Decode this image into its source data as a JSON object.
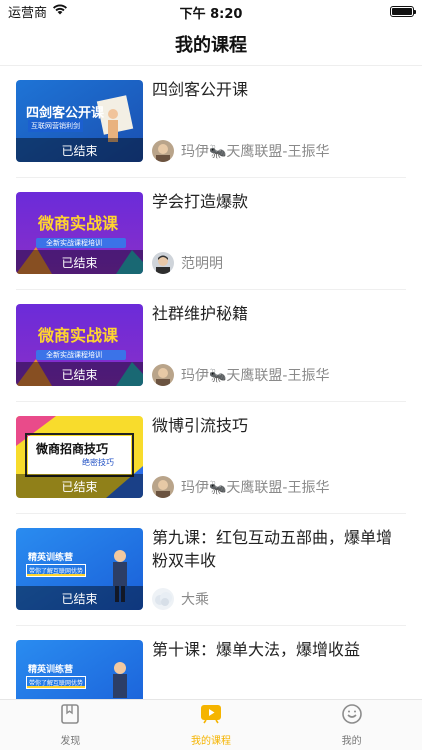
{
  "status_bar": {
    "carrier": "运营商",
    "time": "下午 8:20"
  },
  "nav": {
    "title": "我的课程"
  },
  "courses": [
    {
      "title": "四剑客公开课",
      "thumb_text": "四剑客公开课",
      "thumb_subtext": "互联网营销利剑",
      "status": "已结束",
      "teacher": "玛伊🐜天鹰联盟-王振华"
    },
    {
      "title": "学会打造爆款",
      "thumb_text": "微商实战课",
      "thumb_subtext": "全新实战课程培训",
      "status": "已结束",
      "teacher": "范明明"
    },
    {
      "title": "社群维护秘籍",
      "thumb_text": "微商实战课",
      "thumb_subtext": "全新实战课程培训",
      "status": "已结束",
      "teacher": "玛伊🐜天鹰联盟-王振华"
    },
    {
      "title": "微博引流技巧",
      "thumb_text": "微商招商技巧",
      "thumb_subtext": "绝密技巧",
      "status": "已结束",
      "teacher": "玛伊🐜天鹰联盟-王振华"
    },
    {
      "title": "第九课：红包互动五部曲，爆单增粉双丰收",
      "thumb_text": "精英训练营",
      "thumb_subtext": "带你了解互联网优势",
      "status": "已结束",
      "teacher": "大乘"
    },
    {
      "title": "第十课：爆单大法，爆增收益",
      "thumb_text": "精英训练营",
      "thumb_subtext": "带你了解互联网优势",
      "status": "",
      "teacher": ""
    }
  ],
  "tabs": [
    {
      "label": "发现",
      "icon": "book-icon"
    },
    {
      "label": "我的课程",
      "icon": "play-icon"
    },
    {
      "label": "我的",
      "icon": "smile-icon"
    }
  ],
  "colors": {
    "accent": "#f5b400",
    "text_secondary": "#8a8a8a"
  }
}
